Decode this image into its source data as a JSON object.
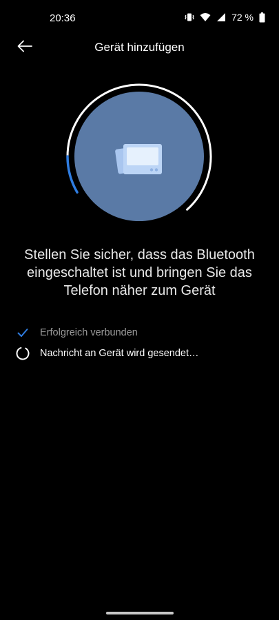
{
  "status_bar": {
    "time": "20:36",
    "battery_percent": "72 %",
    "icons": [
      "vibrate-icon",
      "wifi-icon",
      "signal-icon",
      "battery-icon"
    ]
  },
  "header": {
    "back_icon": "arrow-left-icon",
    "title": "Gerät hinzufügen"
  },
  "illustration": {
    "icon": "device-card-icon",
    "circle_color": "#5a7aa6",
    "ring_color": "#ffffff",
    "progress_color": "#2f7de1",
    "progress": 0.12
  },
  "instruction": "Stellen Sie sicher, dass das Bluetooth eingeschaltet ist und bringen Sie das Telefon näher zum Gerät",
  "steps": [
    {
      "label": "Erfolgreich verbunden",
      "state": "done",
      "icon": "check-icon"
    },
    {
      "label": "Nachricht an Gerät wird gesendet…",
      "state": "in-progress",
      "icon": "spinner-icon"
    }
  ],
  "colors": {
    "background": "#000000",
    "accent": "#2f7de1"
  }
}
